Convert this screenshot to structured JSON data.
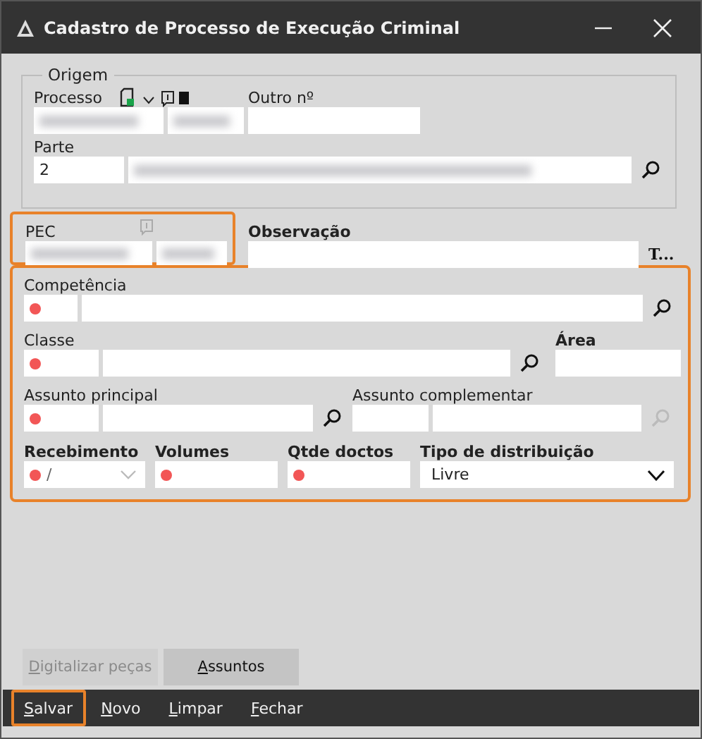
{
  "window": {
    "title": "Cadastro de Processo de Execução Criminal"
  },
  "origem": {
    "legend": "Origem",
    "processo_label": "Processo",
    "outro_label": "Outro nº",
    "parte_label": "Parte",
    "parte_number": "2"
  },
  "pec": {
    "label": "PEC",
    "highlighted": true
  },
  "observacao": {
    "label": "Observação",
    "button": "T..."
  },
  "dados": {
    "highlighted": true
  },
  "competencia": {
    "label": "Competência",
    "required": true
  },
  "classe": {
    "label": "Classe",
    "required": true
  },
  "area": {
    "label": "Área"
  },
  "assunto_principal": {
    "label": "Assunto principal",
    "required": true
  },
  "assunto_complementar": {
    "label": "Assunto complementar",
    "search_disabled": true
  },
  "recebimento": {
    "label": "Recebimento",
    "required": true,
    "value": "/"
  },
  "volumes": {
    "label": "Volumes",
    "required": true
  },
  "qtde_doctos": {
    "label": "Qtde doctos",
    "required": true
  },
  "tipo_distribuicao": {
    "label": "Tipo de distribuição",
    "value": "Livre"
  },
  "actions": [
    {
      "label": "Digitalizar peças",
      "disabled": true
    },
    {
      "label": "Assuntos",
      "disabled": false
    }
  ],
  "toolbar": [
    {
      "label": "Salvar",
      "highlighted": true
    },
    {
      "label": "Novo",
      "highlighted": false
    },
    {
      "label": "Limpar",
      "highlighted": false
    },
    {
      "label": "Fechar",
      "highlighted": false
    }
  ]
}
